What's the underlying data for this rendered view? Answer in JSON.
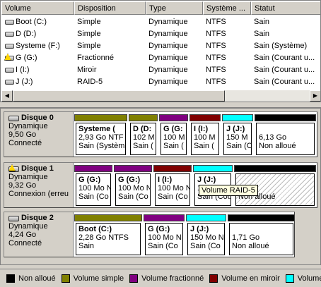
{
  "columns": [
    "Volume",
    "Disposition",
    "Type",
    "Système ...",
    "Statut"
  ],
  "volumes": [
    {
      "name": "Boot (C:)",
      "layout": "Simple",
      "type": "Dynamique",
      "fs": "NTFS",
      "status": "Sain",
      "warning": false
    },
    {
      "name": "D (D:)",
      "layout": "Simple",
      "type": "Dynamique",
      "fs": "NTFS",
      "status": "Sain",
      "warning": false
    },
    {
      "name": "Systeme (F:)",
      "layout": "Simple",
      "type": "Dynamique",
      "fs": "NTFS",
      "status": "Sain (Système)",
      "warning": false
    },
    {
      "name": "G (G:)",
      "layout": "Fractionné",
      "type": "Dynamique",
      "fs": "NTFS",
      "status": "Sain (Courant u...",
      "warning": true
    },
    {
      "name": "I (I:)",
      "layout": "Miroir",
      "type": "Dynamique",
      "fs": "NTFS",
      "status": "Sain (Courant u...",
      "warning": false
    },
    {
      "name": "J (J:)",
      "layout": "RAID-5",
      "type": "Dynamique",
      "fs": "NTFS",
      "status": "Sain (Courant u...",
      "warning": false
    }
  ],
  "colors": {
    "unallocated": "#000000",
    "simple": "#808000",
    "spanned": "#800080",
    "mirror": "#800000",
    "raid5": "#00ffff"
  },
  "disks": [
    {
      "name": "Disque 0",
      "type": "Dynamique",
      "size": "9,50 Go",
      "status": "Connecté",
      "warning": false,
      "partitions": [
        {
          "kind": "simple",
          "label": "Systeme  (",
          "size": "2,93 Go NTF",
          "status": "Sain (Systèm"
        },
        {
          "kind": "simple",
          "label": "D  (D:",
          "size": "102 M",
          "status": "Sain ("
        },
        {
          "kind": "spanned",
          "label": "G  (G:",
          "size": "100 M",
          "status": "Sain ("
        },
        {
          "kind": "mirror",
          "label": "I  (I:)",
          "size": "100 M",
          "status": "Sain ("
        },
        {
          "kind": "raid5",
          "label": "J  (J:)",
          "size": "150 M",
          "status": "Sain (C"
        },
        {
          "kind": "unallocated",
          "label": "",
          "size": "6,13 Go",
          "status": "Non alloué"
        }
      ]
    },
    {
      "name": "Disque 1",
      "type": "Dynamique",
      "size": "9,32 Go",
      "status": "Connexion (erreu",
      "warning": true,
      "partitions": [
        {
          "kind": "spanned",
          "label": "G  (G:)",
          "size": "100 Mo N",
          "status": "Sain (Co"
        },
        {
          "kind": "spanned",
          "label": "G  (G:)",
          "size": "100 Mo N",
          "status": "Sain (Co"
        },
        {
          "kind": "mirror",
          "label": "I  (I:)",
          "size": "100 Mo N",
          "status": "Sain (Co"
        },
        {
          "kind": "raid5",
          "label": "J  (J:)",
          "size": "150 Mo N",
          "status": "Sain (Cou"
        },
        {
          "kind": "unallocated",
          "label": "",
          "size": "8 Go",
          "status": "Non alloué",
          "hatch": true
        }
      ]
    },
    {
      "name": "Disque 2",
      "type": "Dynamique",
      "size": "4,24 Go",
      "status": "Connecté",
      "warning": false,
      "partitions": [
        {
          "kind": "simple",
          "label": "Boot  (C:)",
          "size": "2,28 Go NTFS",
          "status": "Sain"
        },
        {
          "kind": "spanned",
          "label": "G  (G:)",
          "size": "100 Mo N",
          "status": "Sain (Co"
        },
        {
          "kind": "raid5",
          "label": "J  (J:)",
          "size": "150 Mo N",
          "status": "Sain (Co"
        },
        {
          "kind": "unallocated",
          "label": "",
          "size": "1,71 Go",
          "status": "Non alloué"
        }
      ]
    }
  ],
  "tooltip": "Volume RAID-5",
  "legend": [
    {
      "kind": "unallocated",
      "label": "Non alloué"
    },
    {
      "kind": "simple",
      "label": "Volume simple"
    },
    {
      "kind": "spanned",
      "label": "Volume fractionné"
    },
    {
      "kind": "mirror",
      "label": "Volume en miroir"
    },
    {
      "kind": "raid5",
      "label": "Volume RAID-5"
    }
  ]
}
